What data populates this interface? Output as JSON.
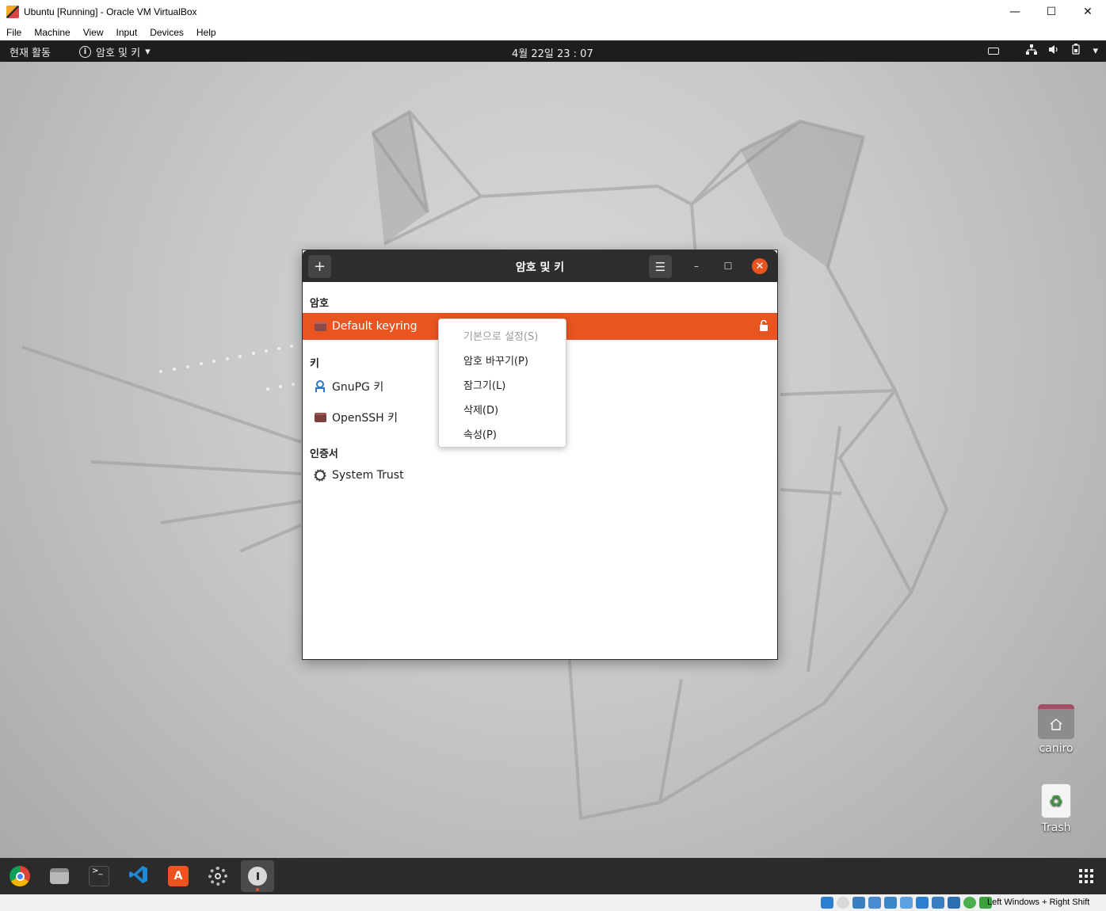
{
  "host": {
    "window_title": "Ubuntu [Running] - Oracle VM VirtualBox",
    "menu": [
      "File",
      "Machine",
      "View",
      "Input",
      "Devices",
      "Help"
    ],
    "controls": {
      "minimize": "—",
      "maximize": "☐",
      "close": "✕"
    },
    "status_hostkey": "Left Windows + Right Shift"
  },
  "topbar": {
    "activities": "현재 활동",
    "app_menu": "암호 및 키",
    "app_menu_icon": "i",
    "arrow": "▾",
    "clock": "4월 22일  23 : 07",
    "tray_icons": [
      "keyboard-icon",
      "network-icon",
      "volume-icon",
      "battery-icon",
      "chevron-down-icon"
    ]
  },
  "window": {
    "title": "암호 및 키",
    "add_glyph": "+",
    "menu_glyph": "☰",
    "min_glyph": "–",
    "max_glyph": "☐",
    "close_glyph": "✕",
    "sections": {
      "passwords": "암호",
      "keys": "키",
      "certificates": "인증서"
    },
    "rows": {
      "default_keyring": "Default keyring",
      "gnupg": "GnuPG 키",
      "openssh": "OpenSSH 키",
      "system_trust": "System Trust"
    }
  },
  "context_menu": {
    "items": [
      {
        "label": "기본으로 설정(S)",
        "enabled": false
      },
      {
        "label": "암호 바꾸기(P)",
        "enabled": true
      },
      {
        "label": "잠그기(L)",
        "enabled": true
      },
      {
        "label": "삭제(D)",
        "enabled": true
      },
      {
        "label": "속성(P)",
        "enabled": true
      }
    ]
  },
  "desktop": {
    "home_label": "caniro",
    "trash_label": "Trash"
  },
  "dock": {
    "apps": [
      "chrome-icon",
      "files-icon",
      "terminal-icon",
      "vscode-icon",
      "software-icon",
      "settings-icon",
      "passwords-keys-icon"
    ],
    "apps_grid_glyph": "⋮⋮⋮"
  },
  "colors": {
    "accent": "#e95420",
    "topbar": "#1d1d1d",
    "dock": "#2b2b2b"
  }
}
